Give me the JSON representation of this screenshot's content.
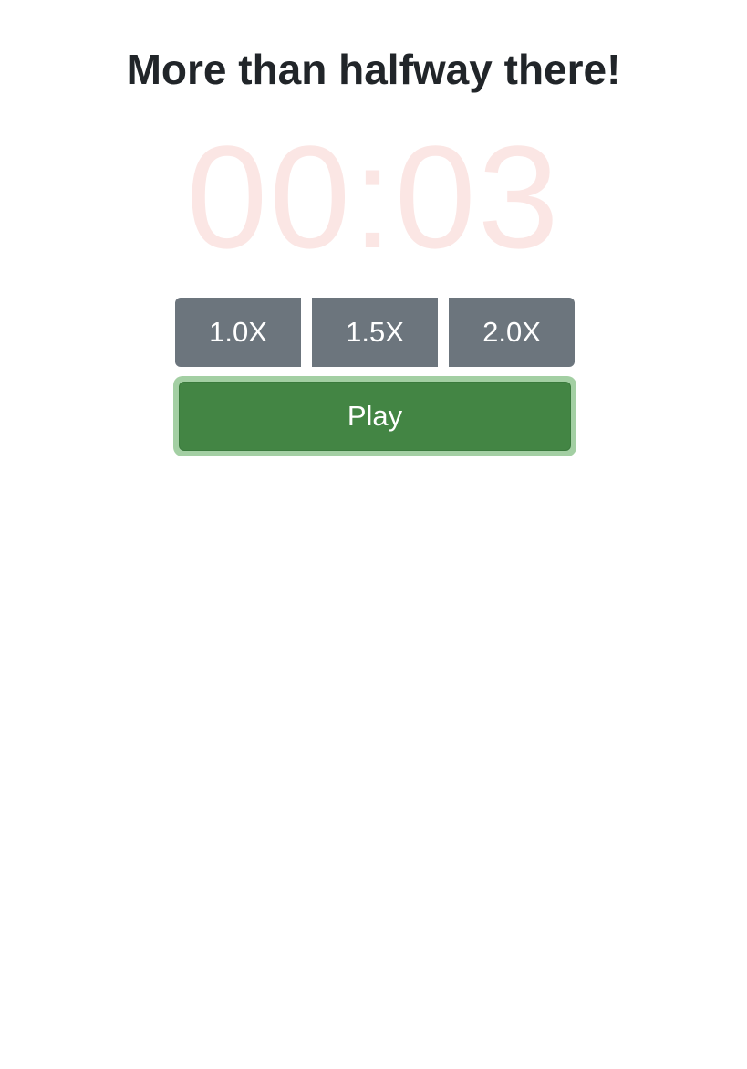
{
  "heading": "More than halfway there!",
  "timer": {
    "display": "00:03",
    "color": "#fbe6e4"
  },
  "speed_options": [
    {
      "label": "1.0X"
    },
    {
      "label": "1.5X"
    },
    {
      "label": "2.0X"
    }
  ],
  "play_button": {
    "label": "Play",
    "color": "#438544",
    "focus_ring_color": "#a3cfa3"
  },
  "speed_button_color": "#6c757d"
}
